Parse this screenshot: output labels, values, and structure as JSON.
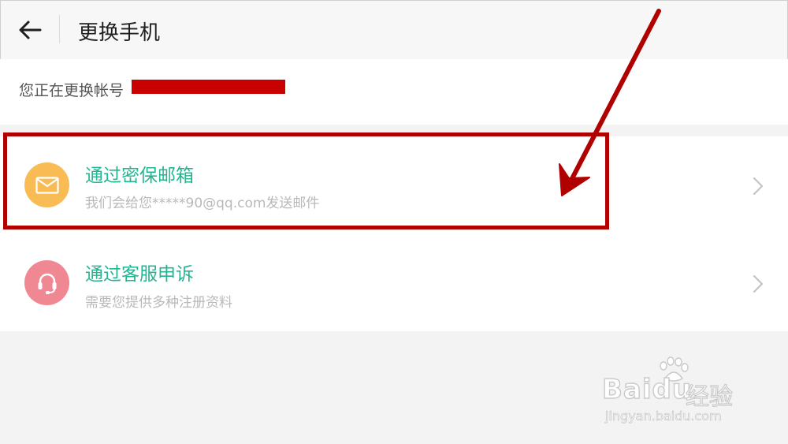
{
  "header": {
    "title": "更换手机",
    "back_icon": "back-arrow-icon"
  },
  "account": {
    "label": "您正在更换帐号"
  },
  "options": [
    {
      "title": "通过密保邮箱",
      "subtitle": "我们会给您*****90@qq.com发送邮件",
      "icon": "mail-icon",
      "icon_color": "#f9bc55"
    },
    {
      "title": "通过客服申诉",
      "subtitle": "需要您提供多种注册资料",
      "icon": "headset-icon",
      "icon_color": "#ef8893"
    }
  ],
  "watermark": {
    "brand": "Bai",
    "brand_tail": "du",
    "product": "经验",
    "url": "jingyan.baidu.com"
  },
  "colors": {
    "accent": "#23b591",
    "annotation": "#b00000"
  }
}
